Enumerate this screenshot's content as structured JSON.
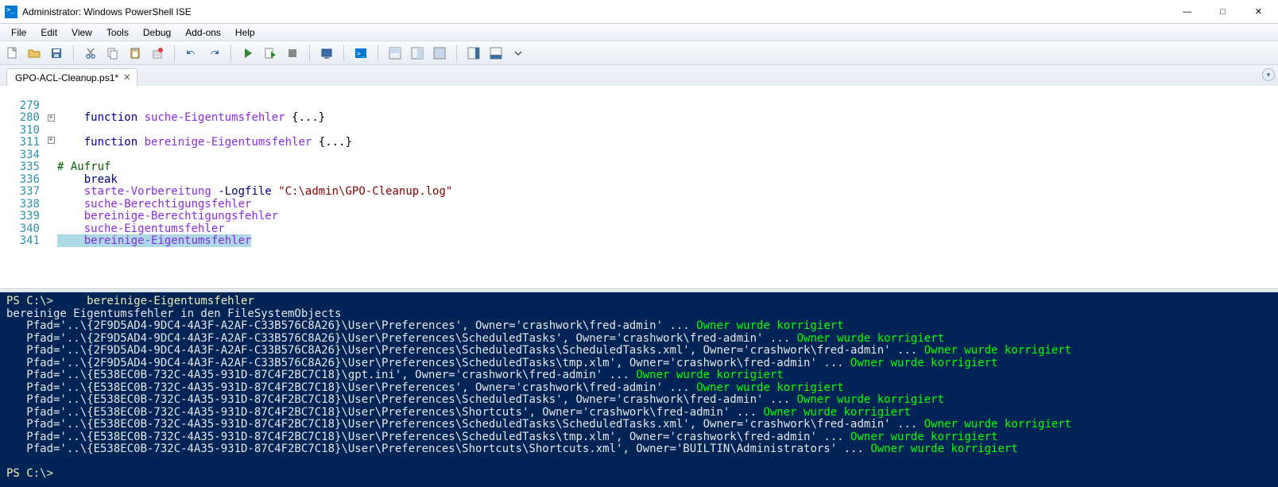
{
  "window": {
    "title": "Administrator: Windows PowerShell ISE"
  },
  "menu": {
    "file": "File",
    "edit": "Edit",
    "view": "View",
    "tools": "Tools",
    "debug": "Debug",
    "addons": "Add-ons",
    "help": "Help"
  },
  "tab": {
    "name": "GPO-ACL-Cleanup.ps1*"
  },
  "gutter": {
    "l0": "",
    "l1": "279",
    "l2": "280",
    "l3": "310",
    "l4": "311",
    "l5": "334",
    "l6": "335",
    "l7": "336",
    "l8": "337",
    "l9": "338",
    "l10": "339",
    "l11": "340",
    "l12": "341"
  },
  "code": {
    "fn_suche": "suche-Eigentumsfehler",
    "fn_bereinige": "bereinige-Eigentumsfehler",
    "comment": "# Aufruf",
    "break": "break",
    "starte": "starte-Vorbereitung",
    "param": "-Logfile",
    "str": "\"C:\\admin\\GPO-Cleanup.log\"",
    "call1": "suche-Berechtigungsfehler",
    "call2": "bereinige-Berechtigungsfehler",
    "call3": "suche-Eigentumsfehler",
    "call4": "bereinige-Eigentumsfehler",
    "function_kw": "function",
    "braces": " {...}"
  },
  "console": {
    "prompt1": "PS C:\\>     bereinige-Eigentumsfehler",
    "header": "bereinige Eigentumsfehler in den FileSystemObjects",
    "rows": [
      {
        "p": "   Pfad='..\\{2F9D5AD4-9DC4-4A3F-A2AF-C33B576C8A26}\\User\\Preferences', Owner='crashwork\\fred-admin' ... ",
        "s": "Owner wurde korrigiert"
      },
      {
        "p": "   Pfad='..\\{2F9D5AD4-9DC4-4A3F-A2AF-C33B576C8A26}\\User\\Preferences\\ScheduledTasks', Owner='crashwork\\fred-admin' ... ",
        "s": "Owner wurde korrigiert"
      },
      {
        "p": "   Pfad='..\\{2F9D5AD4-9DC4-4A3F-A2AF-C33B576C8A26}\\User\\Preferences\\ScheduledTasks\\ScheduledTasks.xml', Owner='crashwork\\fred-admin' ... ",
        "s": "Owner wurde korrigiert"
      },
      {
        "p": "   Pfad='..\\{2F9D5AD4-9DC4-4A3F-A2AF-C33B576C8A26}\\User\\Preferences\\ScheduledTasks\\tmp.xlm', Owner='crashwork\\fred-admin' ... ",
        "s": "Owner wurde korrigiert"
      },
      {
        "p": "   Pfad='..\\{E538EC0B-732C-4A35-931D-87C4F2BC7C18}\\gpt.ini', Owner='crashwork\\fred-admin' ... ",
        "s": "Owner wurde korrigiert"
      },
      {
        "p": "   Pfad='..\\{E538EC0B-732C-4A35-931D-87C4F2BC7C18}\\User\\Preferences', Owner='crashwork\\fred-admin' ... ",
        "s": "Owner wurde korrigiert"
      },
      {
        "p": "   Pfad='..\\{E538EC0B-732C-4A35-931D-87C4F2BC7C18}\\User\\Preferences\\ScheduledTasks', Owner='crashwork\\fred-admin' ... ",
        "s": "Owner wurde korrigiert"
      },
      {
        "p": "   Pfad='..\\{E538EC0B-732C-4A35-931D-87C4F2BC7C18}\\User\\Preferences\\Shortcuts', Owner='crashwork\\fred-admin' ... ",
        "s": "Owner wurde korrigiert"
      },
      {
        "p": "   Pfad='..\\{E538EC0B-732C-4A35-931D-87C4F2BC7C18}\\User\\Preferences\\ScheduledTasks\\ScheduledTasks.xml', Owner='crashwork\\fred-admin' ... ",
        "s": "Owner wurde korrigiert"
      },
      {
        "p": "   Pfad='..\\{E538EC0B-732C-4A35-931D-87C4F2BC7C18}\\User\\Preferences\\ScheduledTasks\\tmp.xlm', Owner='crashwork\\fred-admin' ... ",
        "s": "Owner wurde korrigiert"
      },
      {
        "p": "   Pfad='..\\{E538EC0B-732C-4A35-931D-87C4F2BC7C18}\\User\\Preferences\\Shortcuts\\Shortcuts.xml', Owner='BUILTIN\\Administrators' ... ",
        "s": "Owner wurde korrigiert"
      }
    ],
    "prompt2": "PS C:\\> "
  }
}
